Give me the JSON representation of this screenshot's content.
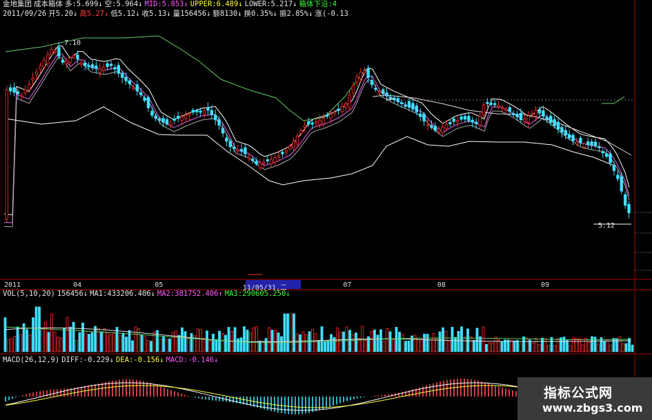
{
  "header": {
    "line1": [
      {
        "t": "金地集团",
        "c": "c-w"
      },
      {
        "t": "成本箱体",
        "c": "c-w"
      },
      {
        "t": "多:5.699↓",
        "c": "c-w"
      },
      {
        "t": "空:5.964↓",
        "c": "c-w"
      },
      {
        "t": "MID:5.853↓",
        "c": "c-m"
      },
      {
        "t": "UPPER:6.489↓",
        "c": "c-y"
      },
      {
        "t": "LOWER:5.217↓",
        "c": "c-w"
      },
      {
        "t": "箱体下沿:4",
        "c": "c-g"
      }
    ],
    "line2": [
      {
        "t": "2011/09/26",
        "c": "c-w"
      },
      {
        "t": "开5.20↓",
        "c": "c-w"
      },
      {
        "t": "高5.27↓",
        "c": "c-r"
      },
      {
        "t": "低5.12↓",
        "c": "c-w"
      },
      {
        "t": "收5.13↓",
        "c": "c-w"
      },
      {
        "t": "量156456↓",
        "c": "c-w"
      },
      {
        "t": "额8130↓",
        "c": "c-w"
      },
      {
        "t": "换0.35%↓",
        "c": "c-w"
      },
      {
        "t": "振2.85%↓",
        "c": "c-w"
      },
      {
        "t": "涨(-0.13",
        "c": "c-w"
      }
    ]
  },
  "price_labels": {
    "high": "7.10",
    "last": "5.12"
  },
  "time_axis": [
    {
      "label": "2011",
      "pos": 0
    },
    {
      "label": "04",
      "pos": 0.11
    },
    {
      "label": "05",
      "pos": 0.24
    },
    {
      "label": "11/05/31,二",
      "pos": 0.38
    },
    {
      "label": "07",
      "pos": 0.54
    },
    {
      "label": "08",
      "pos": 0.69
    },
    {
      "label": "09",
      "pos": 0.855
    }
  ],
  "vol_header": [
    {
      "t": "VOL(5,10,20)",
      "c": "c-w"
    },
    {
      "t": "156456↓",
      "c": "c-w"
    },
    {
      "t": "MA1:433206.406↓",
      "c": "c-w"
    },
    {
      "t": "MA2:381752.406↑",
      "c": "c-m"
    },
    {
      "t": "MA3:290605.250↓",
      "c": "c-g"
    }
  ],
  "macd_header": [
    {
      "t": "MACD(26,12,9)",
      "c": "c-w"
    },
    {
      "t": "DIFF:-0.229↓",
      "c": "c-w"
    },
    {
      "t": "DEA:-0.156↓",
      "c": "c-y"
    },
    {
      "t": "MACD:-0.146↓",
      "c": "c-m"
    }
  ],
  "watermark": {
    "title": "指标公式网",
    "url": "www.zbgs3.com"
  },
  "colors": {
    "up": "#ff3030",
    "down": "#40e0ff",
    "mid": "#cc55cc",
    "upper": "#66cc66",
    "lower": "#ffffff",
    "ma": "#ffffff",
    "bg": "#000000",
    "frame": "#aa0000"
  }
}
